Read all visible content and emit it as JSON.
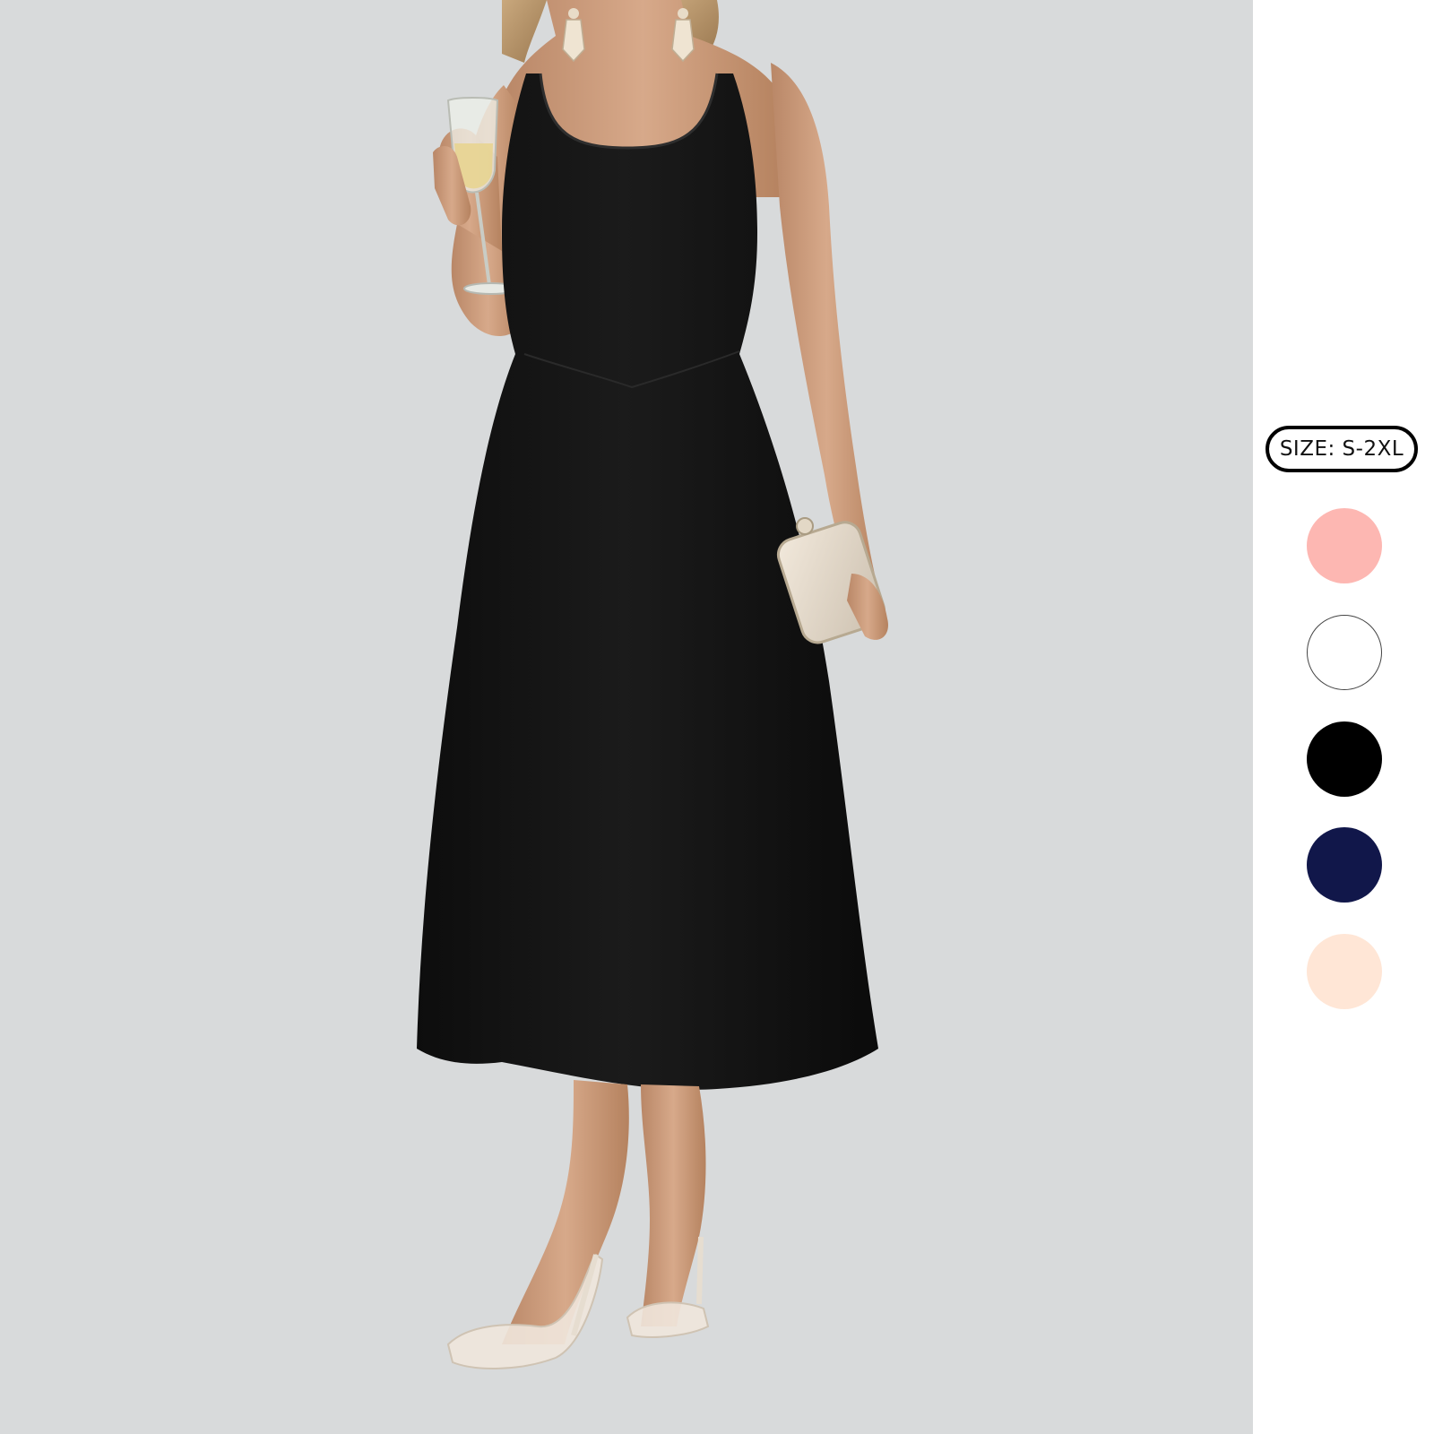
{
  "product_image": {
    "subject": "dress-photo",
    "background_color": "#d8dadb",
    "dress_color": "#141414"
  },
  "size_badge": {
    "label": "SIZE: S-2XL"
  },
  "color_swatches": [
    {
      "name": "pink",
      "hex": "#fdb7b2"
    },
    {
      "name": "white",
      "hex": "#ffffff"
    },
    {
      "name": "black",
      "hex": "#000000"
    },
    {
      "name": "navy",
      "hex": "#11174a"
    },
    {
      "name": "apricot",
      "hex": "#ffe6d6"
    }
  ]
}
